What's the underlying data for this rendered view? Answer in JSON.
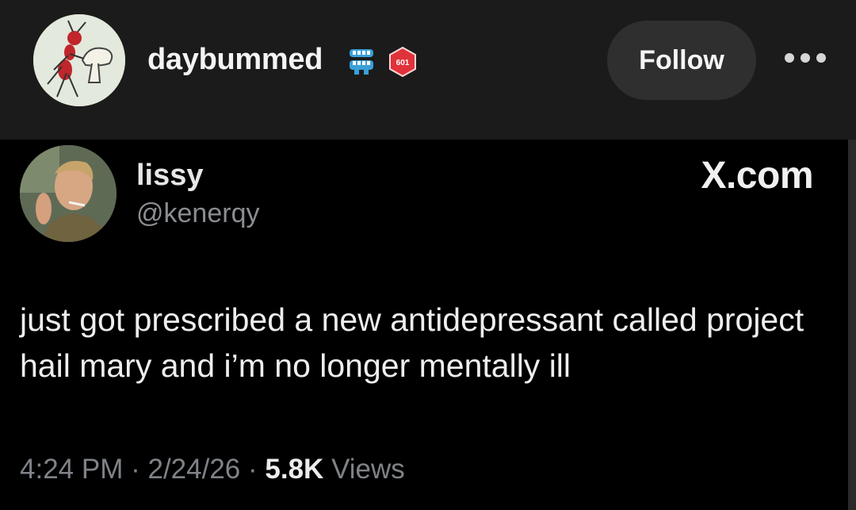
{
  "post": {
    "author": {
      "username": "daybummed",
      "avatar_icon": "red-ant-mushroom-drawing",
      "badges": [
        "denture-teeth-icon",
        "red-d20-badge-icon"
      ],
      "badge_text": "601"
    },
    "follow_label": "Follow",
    "more_icon": "more-options-icon"
  },
  "tweet": {
    "display_name": "lissy",
    "handle": "@kenerqy",
    "source": "X.com",
    "text": "just got prescribed a new antidepressant called project hail mary and i’m no longer mentally ill",
    "time": "4:24 PM",
    "date": "2/24/26",
    "sep": "·",
    "views_count": "5.8K",
    "views_label": "Views"
  }
}
